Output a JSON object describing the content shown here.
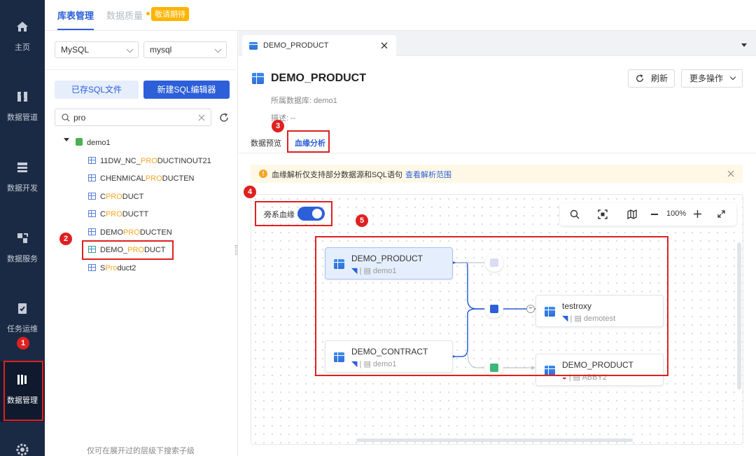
{
  "nav": {
    "items": [
      {
        "label": "主页",
        "icon": "home-icon"
      },
      {
        "label": "数据管道",
        "icon": "pipeline-icon"
      },
      {
        "label": "数据开发",
        "icon": "dev-icon"
      },
      {
        "label": "数据服务",
        "icon": "service-icon"
      },
      {
        "label": "任务运维",
        "icon": "task-icon"
      },
      {
        "label": "数据管理",
        "icon": "data-manage-icon"
      }
    ]
  },
  "top_tabs": {
    "active": "库表管理",
    "second": "数据质量",
    "badge": "敬请期待"
  },
  "left": {
    "db_type": "MySQL",
    "db_name": "mysql",
    "saved_sql": "已存SQL文件",
    "new_sql": "新建SQL编辑器",
    "search_value": "pro",
    "tree_root": "demo1",
    "tables": [
      {
        "pre": "11DW_NC_",
        "hl": "PRO",
        "post": "DUCTINOUT21"
      },
      {
        "pre": "CHENMICAL",
        "hl": "PRO",
        "post": "DUCTEN"
      },
      {
        "pre": "C",
        "hl": "PRO",
        "post": "DUCT"
      },
      {
        "pre": "C",
        "hl": "PRO",
        "post": "DUCTT"
      },
      {
        "pre": "DEMO",
        "hl": "PRO",
        "post": "DUCTEN"
      },
      {
        "pre": "DEMO_",
        "hl": "PRO",
        "post": "DUCT"
      },
      {
        "pre": "S",
        "hl": "Pro",
        "post": "duct2"
      }
    ],
    "footer": "仅可在展开过的层级下搜索子级"
  },
  "file_tab": {
    "title": "DEMO_PRODUCT"
  },
  "header": {
    "title": "DEMO_PRODUCT",
    "db_line": "所属数据库: demo1",
    "desc_line": "描述: --",
    "refresh": "刷新",
    "more": "更多操作"
  },
  "tabs": {
    "preview": "数据预览",
    "lineage": "血缘分析"
  },
  "notice": {
    "text": "血缘解析仅支持部分数据源和SQL语句",
    "link": "查看解析范围"
  },
  "toggle": {
    "label": "旁系血缘",
    "on": true
  },
  "toolbar": {
    "zoom": "100%"
  },
  "nodes": {
    "n1": {
      "title": "DEMO_PRODUCT",
      "sub": "demo1"
    },
    "n2": {
      "title": "DEMO_CONTRACT",
      "sub": "demo1"
    },
    "n3": {
      "title": "testroxy",
      "sub": "demotest"
    },
    "n4": {
      "title": "DEMO_PRODUCT",
      "sub": "ABBY2"
    }
  },
  "annotations": [
    "1",
    "2",
    "3",
    "4",
    "5"
  ],
  "colors": {
    "nav_bg": "#1b2a44",
    "primary": "#2c5fd8",
    "highlight": "#f5a623",
    "annotation": "#e02020"
  }
}
